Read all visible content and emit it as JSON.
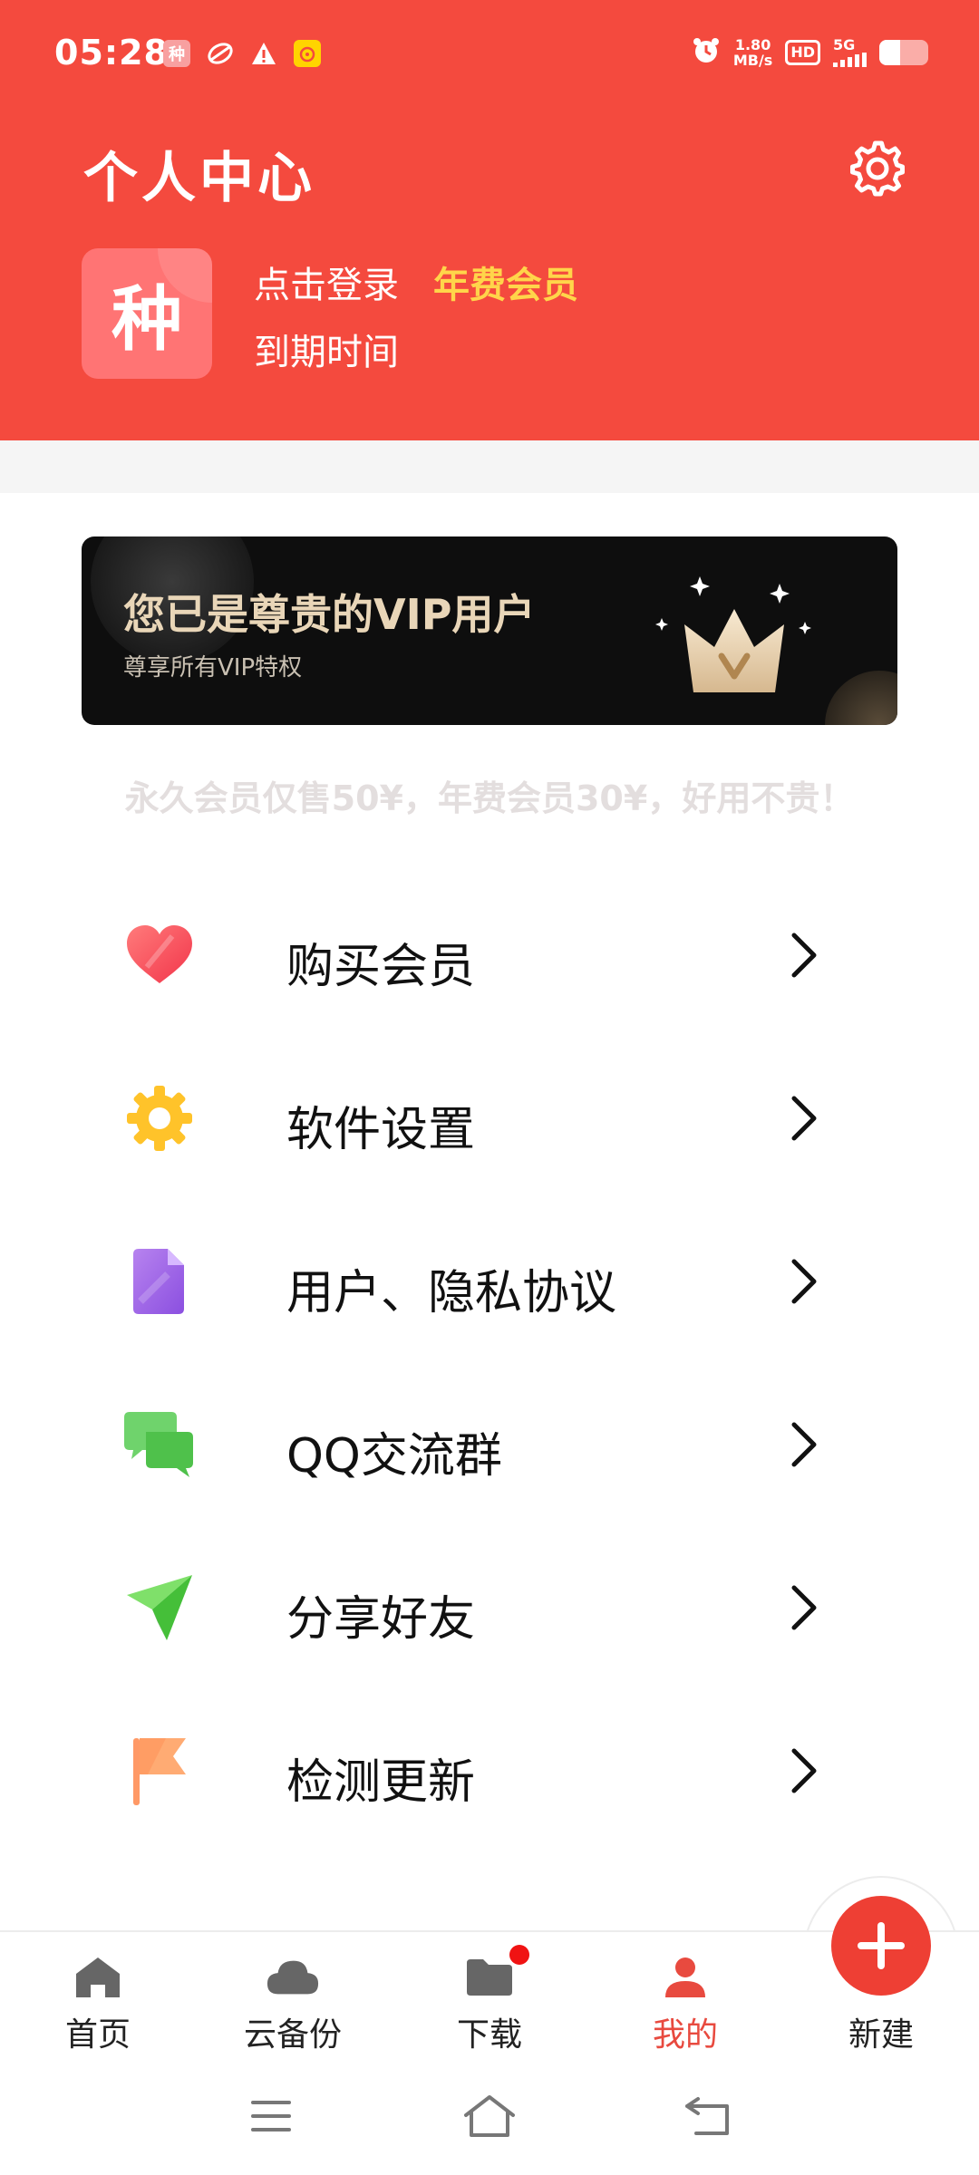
{
  "status_bar": {
    "time": "05:28",
    "notif_app_char": "种",
    "speed_value": "1.80",
    "speed_unit": "MB/s",
    "hd": "HD",
    "network": "5G",
    "icons": [
      "app-notification-icon",
      "swirl-icon",
      "warning-icon",
      "reminder-icon",
      "alarm-icon",
      "hd-icon",
      "signal-icon",
      "battery-icon"
    ]
  },
  "header": {
    "title": "个人中心",
    "avatar_char": "种",
    "login_label": "点击登录",
    "member_type": "年费会员",
    "expiry_label": "到期时间",
    "accent_color": "#f44a3e",
    "member_color": "#ffd54a"
  },
  "vip_banner": {
    "title": "您已是尊贵的VIP用户",
    "subtitle": "尊享所有VIP特权"
  },
  "promo_text": "永久会员仅售50¥，年费会员30¥，好用不贵！",
  "menu": [
    {
      "label": "购买会员",
      "icon": "heart-icon"
    },
    {
      "label": "软件设置",
      "icon": "gear-icon"
    },
    {
      "label": "用户、隐私协议",
      "icon": "document-icon"
    },
    {
      "label": "QQ交流群",
      "icon": "chat-icon"
    },
    {
      "label": "分享好友",
      "icon": "paper-plane-icon"
    },
    {
      "label": "检测更新",
      "icon": "flag-icon"
    }
  ],
  "bottom_nav": {
    "items": [
      {
        "label": "首页",
        "icon": "home-icon"
      },
      {
        "label": "云备份",
        "icon": "cloud-icon"
      },
      {
        "label": "下载",
        "icon": "folder-icon"
      },
      {
        "label": "我的",
        "icon": "person-icon"
      }
    ],
    "active_index": 3,
    "fab_label": "新建"
  },
  "system_nav": [
    "menu-icon",
    "home-outline-icon",
    "back-icon"
  ]
}
